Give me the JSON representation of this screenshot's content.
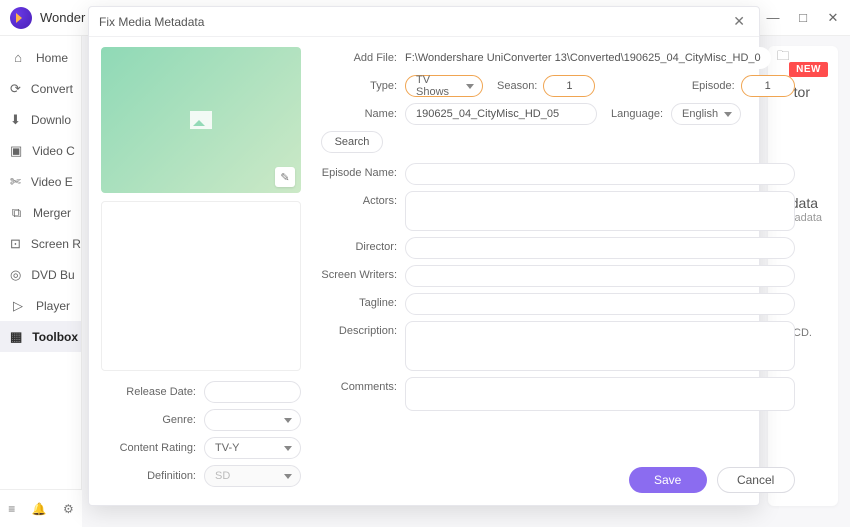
{
  "app": {
    "name": "Wonder"
  },
  "window_controls": {
    "min": "—",
    "max": "□",
    "close": "✕"
  },
  "sidebar": {
    "items": [
      {
        "icon": "⌂",
        "label": "Home"
      },
      {
        "icon": "⟳",
        "label": "Convert"
      },
      {
        "icon": "⬇",
        "label": "Downlo"
      },
      {
        "icon": "▣",
        "label": "Video C"
      },
      {
        "icon": "✄",
        "label": "Video E"
      },
      {
        "icon": "⧉",
        "label": "Merger"
      },
      {
        "icon": "⊡",
        "label": "Screen R"
      },
      {
        "icon": "◎",
        "label": "DVD Bu"
      },
      {
        "icon": "▷",
        "label": "Player"
      },
      {
        "icon": "▦",
        "label": "Toolbox"
      }
    ],
    "active_index": 9
  },
  "bottombar": {
    "icons": [
      "≡",
      "🔔",
      "⚙"
    ]
  },
  "background": {
    "new_badge": "NEW",
    "text1": "tor",
    "text2": "data",
    "text3": "tetadata",
    "text4": "CD."
  },
  "modal": {
    "title": "Fix Media Metadata",
    "add_file": {
      "label": "Add File:",
      "value": "F:\\Wondershare UniConverter 13\\Converted\\190625_04_CityMisc_HD_0"
    },
    "type": {
      "label": "Type:",
      "value": "TV Shows"
    },
    "season": {
      "label": "Season:",
      "value": "1"
    },
    "episode": {
      "label": "Episode:",
      "value": "1"
    },
    "name": {
      "label": "Name:",
      "value": "190625_04_CityMisc_HD_05"
    },
    "language": {
      "label": "Language:",
      "value": "English"
    },
    "search_label": "Search",
    "fields": {
      "episode_name": "Episode Name:",
      "actors": "Actors:",
      "director": "Director:",
      "screen_writers": "Screen Writers:",
      "tagline": "Tagline:",
      "description": "Description:",
      "comments": "Comments:"
    },
    "left_fields": {
      "release_date": "Release Date:",
      "genre": "Genre:",
      "content_rating": {
        "label": "Content Rating:",
        "value": "TV-Y"
      },
      "definition": {
        "label": "Definition:",
        "value": "SD"
      }
    },
    "actions": {
      "save": "Save",
      "cancel": "Cancel"
    }
  }
}
